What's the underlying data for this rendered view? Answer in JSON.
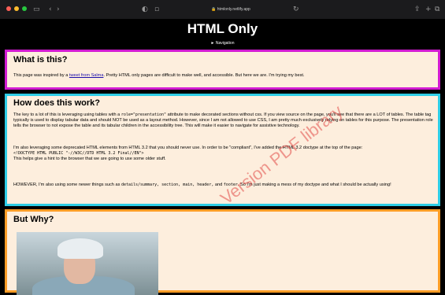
{
  "browser": {
    "url": "htmlonly.netlify.app",
    "colors": {
      "close": "#ff5f57",
      "minimize": "#febc2e",
      "maximize": "#28c840"
    }
  },
  "header": {
    "title": "HTML Only",
    "nav_label": "► Navigation"
  },
  "section1": {
    "heading": "What is this?",
    "p_before": "This page was inspired by a ",
    "link": "tweet from Salma",
    "p_after": ". Pretty HTML only pages are difficult to make well, and accessible. But here we are. I'm trying my best."
  },
  "section2": {
    "heading": "How does this work?",
    "p1_a": "The key to a lot of this is leveraging using tables with a ",
    "p1_code": "role=\"presentation\"",
    "p1_b": " attribute to make decorated sections without css. If you view source on the page, you'll see that there are a LOT of tables. The table tag typically is used to display tabular data and should NOT be used as a layout method. However, since I am not allowed to use CSS, I am pretty much exclusively relying on tables for this purpose. The presentation role tells the browser to not expose the table and its tabular children in the accessibility tree. This will make it easier to navigate for assistive technology.",
    "p2_a": "I'm also leveraging some deprecated HTML elements from HTML 3.2 that you should never use. In order to be \"compliant\", I've added the HTML 3.2 doctype at the top of the page:",
    "doctype": "<!DOCTYPE HTML PUBLIC \"-//W3C//DTD HTML 3.2 Final//EN\">",
    "p2_b": "This helps give a hint to the browser that we are going to use some older stuff.",
    "p3_a": "HOWEVER, I'm also using some newer things such as ",
    "p3_code": "details/summary, section, main, header,",
    "p3_b": " and ",
    "p3_code2": "footer",
    "p3_c": ". So I'm just making a mess of my doctype and what I should be actually using!"
  },
  "section3": {
    "heading": "But Why?"
  },
  "watermark": "Version PDF library"
}
